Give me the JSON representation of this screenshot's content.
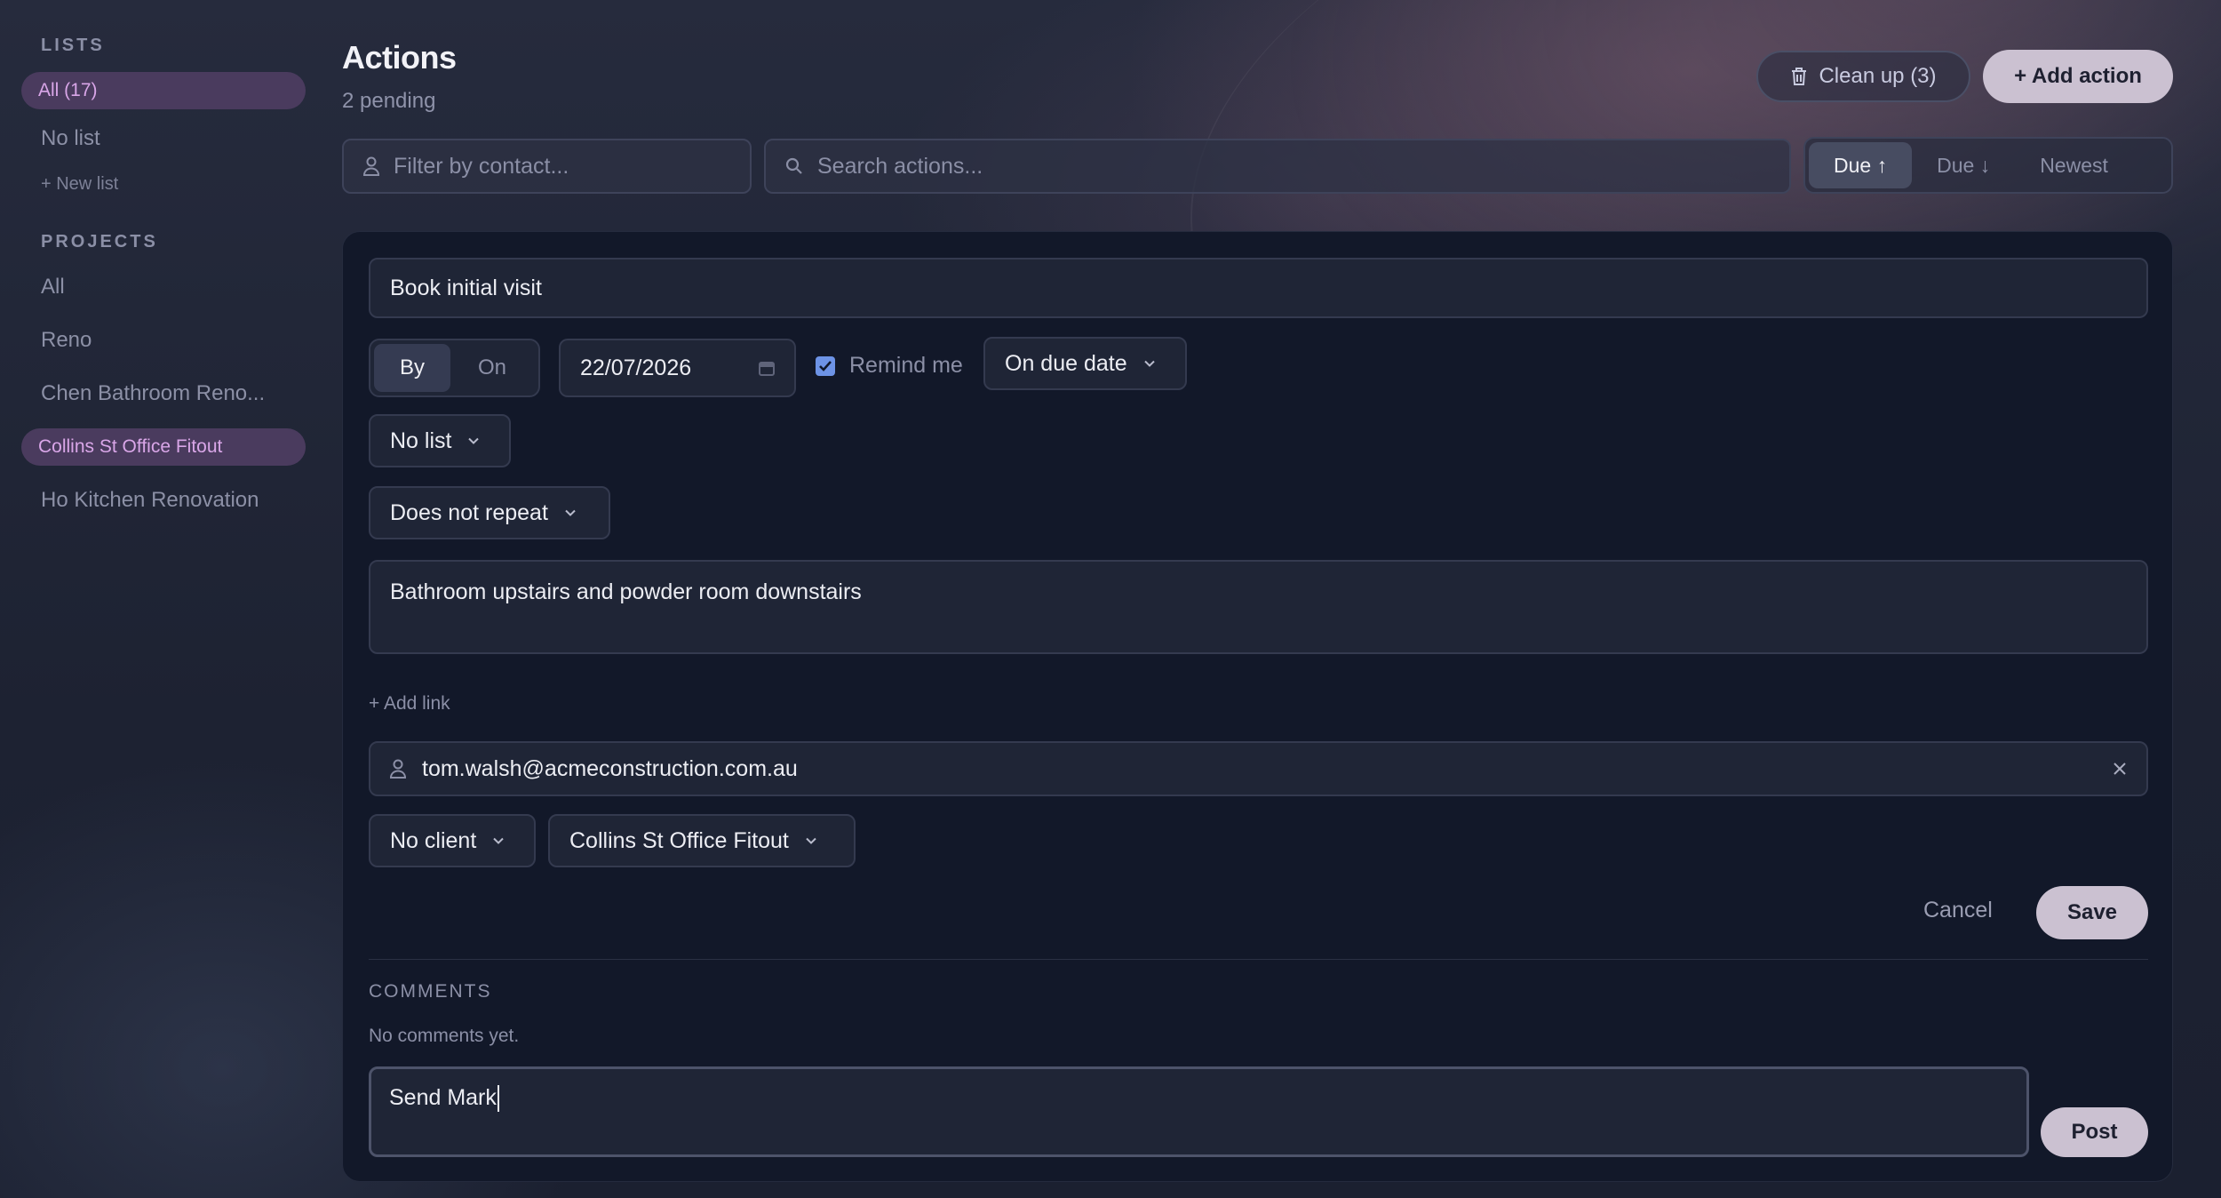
{
  "sidebar": {
    "lists_title": "LISTS",
    "lists": [
      {
        "label": "All (17)",
        "active": true
      },
      {
        "label": "No list",
        "active": false
      }
    ],
    "new_list": "+ New list",
    "projects_title": "PROJECTS",
    "projects": [
      {
        "label": "All",
        "active": false
      },
      {
        "label": "Reno",
        "active": false
      },
      {
        "label": "Chen Bathroom Reno...",
        "active": false
      },
      {
        "label": "Collins St Office Fitout",
        "active": true
      },
      {
        "label": "Ho Kitchen Renovation",
        "active": false
      }
    ]
  },
  "header": {
    "title": "Actions",
    "subtitle": "2 pending",
    "cleanup_label": "Clean up (3)",
    "add_label": "+ Add action"
  },
  "filters": {
    "contact_placeholder": "Filter by contact...",
    "search_placeholder": "Search actions...",
    "sort": [
      {
        "label": "Due ↑",
        "active": true
      },
      {
        "label": "Due ↓",
        "active": false
      },
      {
        "label": "Newest",
        "active": false
      }
    ]
  },
  "editor": {
    "title_value": "Book initial visit",
    "mode": [
      {
        "label": "By",
        "active": true
      },
      {
        "label": "On",
        "active": false
      }
    ],
    "date_value": "22/07/2026",
    "remind_label": "Remind me",
    "remind_checked": true,
    "reminder_when": "On due date",
    "list_value": "No list",
    "repeat_value": "Does not repeat",
    "notes_value": "Bathroom upstairs and powder room downstairs",
    "add_link": "+ Add link",
    "contact_value": "tom.walsh@acmeconstruction.com.au",
    "client_value": "No client",
    "project_value": "Collins St Office Fitout",
    "cancel_label": "Cancel",
    "save_label": "Save"
  },
  "comments": {
    "title": "COMMENTS",
    "empty_text": "No comments yet.",
    "draft_value": "Send Mark",
    "post_label": "Post"
  },
  "colors": {
    "accent_active_bg": "#4a3b5e",
    "accent_active_text": "#d9a6e8",
    "primary_button": "#cbc1d1",
    "checkbox": "#6d93e6"
  }
}
